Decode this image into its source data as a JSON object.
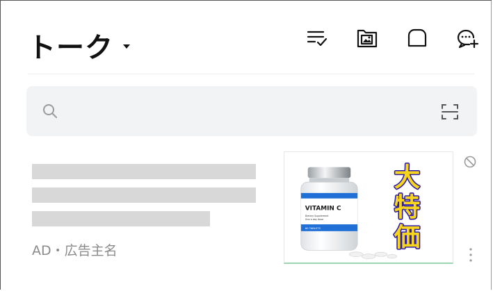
{
  "header": {
    "title": "トーク",
    "icons": [
      "filter-list-icon",
      "image-folder-icon",
      "rounded-square-icon",
      "new-chat-icon"
    ]
  },
  "search": {
    "value": "",
    "placeholder": "",
    "icons": [
      "search-icon",
      "qr-scan-icon"
    ]
  },
  "ad": {
    "label": "AD・広告主名",
    "image": {
      "product_name": "VITAMIN C",
      "product_sub": "Dietary Supplement",
      "product_sub2": "One a day dose",
      "product_strip": "60 TABLETS",
      "promo_chars": [
        "大",
        "特",
        "価"
      ],
      "promo_color": "#f7d51d",
      "promo_outline": "#2a1aa8"
    }
  },
  "colors": {
    "search_bg": "#f2f3f4",
    "placeholder_bar": "#d8d8d8",
    "divider": "#ececec",
    "ad_label": "#8a8a8a"
  }
}
